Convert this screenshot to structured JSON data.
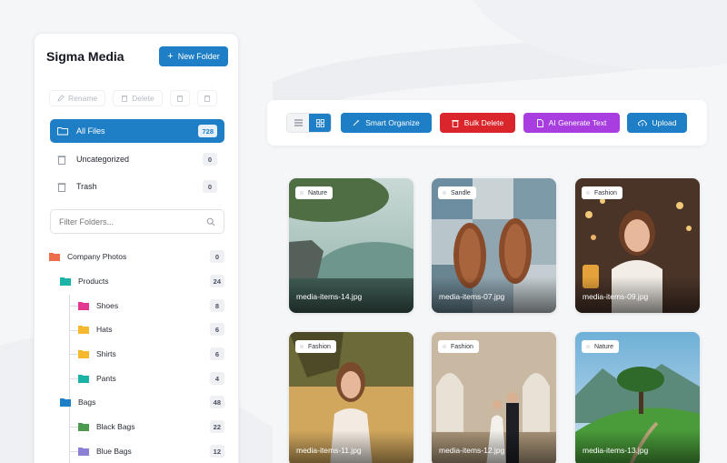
{
  "sidebar": {
    "brand": "Sigma Media",
    "new_folder_label": "New Folder",
    "actions": {
      "rename": "Rename",
      "delete": "Delete"
    },
    "nav": [
      {
        "label": "All Files",
        "count": "728"
      },
      {
        "label": "Uncategorized",
        "count": "0"
      },
      {
        "label": "Trash",
        "count": "0"
      }
    ],
    "filter_placeholder": "Filter Folders...",
    "tree": [
      {
        "label": "Company Photos",
        "count": "0",
        "color": "#ef6c4a"
      },
      {
        "label": "Products",
        "count": "24",
        "color": "#1ab3a6"
      },
      {
        "label": "Shoes",
        "count": "8",
        "color": "#e0398f"
      },
      {
        "label": "Hats",
        "count": "6",
        "color": "#f5b82e"
      },
      {
        "label": "Shirts",
        "count": "6",
        "color": "#f5b82e"
      },
      {
        "label": "Pants",
        "count": "4",
        "color": "#1ab3a6"
      },
      {
        "label": "Bags",
        "count": "48",
        "color": "#1e7fc6"
      },
      {
        "label": "Black Bags",
        "count": "22",
        "color": "#4c9a4f"
      },
      {
        "label": "Blue Bags",
        "count": "12",
        "color": "#8b7fd6"
      }
    ]
  },
  "toolbar": {
    "smart_organize": "Smart Organize",
    "bulk_delete": "Bulk Delete",
    "ai_generate": "AI Generate Text",
    "upload": "Upload"
  },
  "colors": {
    "primary": "#1e7fc6",
    "danger": "#d9252b",
    "purple": "#a93ee0"
  },
  "media": [
    {
      "tag": "Nature",
      "filename": "media-items-14.jpg"
    },
    {
      "tag": "Sandle",
      "filename": "media-items-07.jpg"
    },
    {
      "tag": "Fashion",
      "filename": "media-items-09.jpg"
    },
    {
      "tag": "Fashion",
      "filename": "media-items-11.jpg"
    },
    {
      "tag": "Fashion",
      "filename": "media-items-12.jpg"
    },
    {
      "tag": "Nature",
      "filename": "media-items-13.jpg"
    }
  ]
}
